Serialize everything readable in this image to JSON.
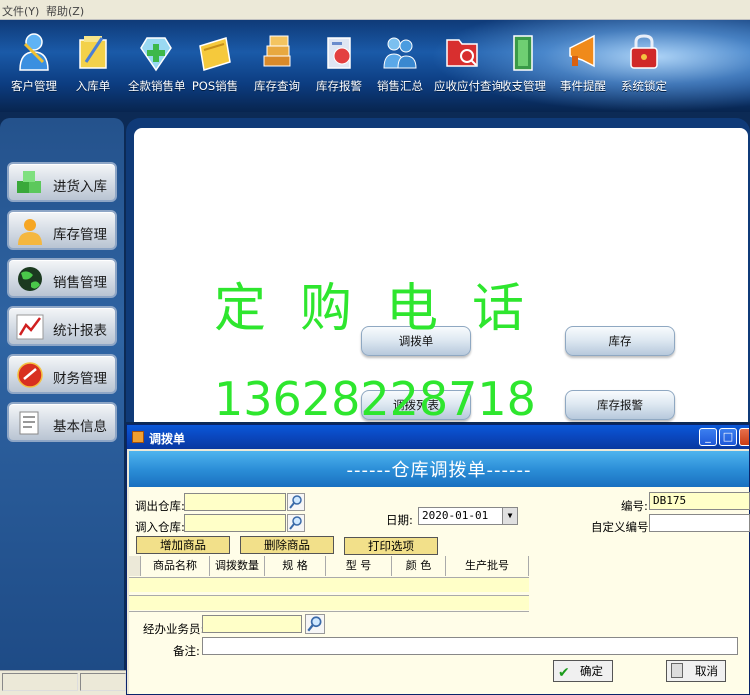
{
  "menu": {
    "file": "文件(Y)",
    "help": "帮助(Z)"
  },
  "toolbar": [
    {
      "label": "客户管理",
      "icon": "customer-icon"
    },
    {
      "label": "入库单",
      "icon": "inbound-icon"
    },
    {
      "label": "全款销售单",
      "icon": "sales-order-icon"
    },
    {
      "label": "POS销售",
      "icon": "pos-icon"
    },
    {
      "label": "库存查询",
      "icon": "inventory-query-icon"
    },
    {
      "label": "库存报警",
      "icon": "inventory-alarm-icon"
    },
    {
      "label": "销售汇总",
      "icon": "sales-summary-icon"
    },
    {
      "label": "应收应付查询",
      "icon": "receivable-icon"
    },
    {
      "label": "收支管理",
      "icon": "finance-icon"
    },
    {
      "label": "事件提醒",
      "icon": "reminder-icon"
    },
    {
      "label": "系统锁定",
      "icon": "lock-icon"
    }
  ],
  "sidebar": [
    {
      "label": "进货入库",
      "icon": "cubes-icon"
    },
    {
      "label": "库存管理",
      "icon": "person-icon"
    },
    {
      "label": "销售管理",
      "icon": "globe-icon"
    },
    {
      "label": "统计报表",
      "icon": "chart-icon"
    },
    {
      "label": "财务管理",
      "icon": "finance-icon"
    },
    {
      "label": "基本信息",
      "icon": "document-icon"
    }
  ],
  "main": {
    "buttons": {
      "transfer": "调拨单",
      "stock": "库存",
      "transfer_list": "调拨列表",
      "stock_alarm": "库存报警"
    },
    "watermark_line1": "定购电话",
    "watermark_line2": "13628228718"
  },
  "dialog": {
    "title": "调拨单",
    "banner": "------仓库调拨单------",
    "labels": {
      "out_warehouse": "调出仓库:",
      "in_warehouse": "调入仓库:",
      "date": "日期:",
      "number": "编号:",
      "custom_number": "自定义编号:",
      "handler": "经办业务员:",
      "remark": "备注:"
    },
    "values": {
      "date": "2020-01-01",
      "number": "DB175",
      "out_warehouse": "",
      "in_warehouse": "",
      "custom_number": "",
      "handler": "",
      "remark": ""
    },
    "actions": {
      "add": "增加商品",
      "delete": "删除商品",
      "print": "打印选项"
    },
    "columns": [
      "商品名称",
      "调拨数量",
      "规 格",
      "型 号",
      "颜 色",
      "生产批号"
    ],
    "ok": "确定",
    "cancel": "取消"
  },
  "colors": {
    "watermark": "#2ee62e",
    "titlebar": "#0a48c0",
    "banner": "#2c8fd8"
  }
}
